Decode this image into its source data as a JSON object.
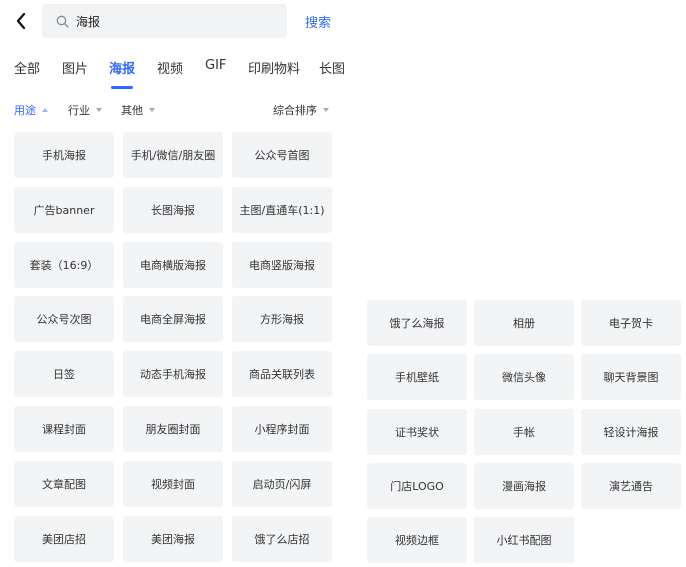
{
  "search": {
    "query": "海报",
    "button_label": "搜索"
  },
  "tabs": [
    "全部",
    "图片",
    "海报",
    "视频",
    "GIF",
    "印刷物料",
    "长图"
  ],
  "active_tab": "海报",
  "filters": {
    "usage": "用途",
    "industry": "行业",
    "other": "其他",
    "sort": "综合排序"
  },
  "left_grid": [
    "手机海报",
    "手机/微信/朋友圈",
    "公众号首图",
    "广告banner",
    "长图海报",
    "主图/直通车(1:1)",
    "套装（16:9）",
    "电商横版海报",
    "电商竖版海报",
    "公众号次图",
    "电商全屏海报",
    "方形海报",
    "日签",
    "动态手机海报",
    "商品关联列表",
    "课程封面",
    "朋友圈封面",
    "小程序封面",
    "文章配图",
    "视频封面",
    "启动页/闪屏",
    "美团店招",
    "美团海报",
    "饿了么店招"
  ],
  "right_grid": [
    "饿了么海报",
    "相册",
    "电子贺卡",
    "手机壁纸",
    "微信头像",
    "聊天背景图",
    "证书奖状",
    "手帐",
    "轻设计海报",
    "门店LOGO",
    "漫画海报",
    "演艺通告",
    "视频边框",
    "小红书配图"
  ],
  "colors": {
    "accent": "#2f6bff",
    "chip_bg": "#f3f4f6"
  },
  "icons": {
    "back": "chevron-left-icon",
    "search": "search-icon"
  }
}
